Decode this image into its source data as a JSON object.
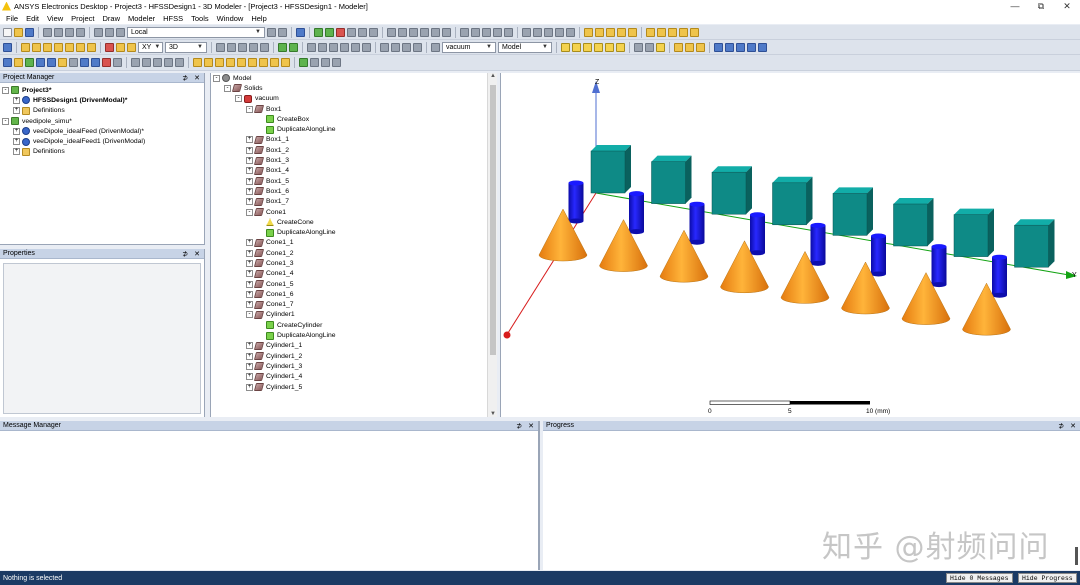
{
  "window": {
    "title": "ANSYS Electronics Desktop - Project3 - HFSSDesign1 - 3D Modeler - [Project3 - HFSSDesign1 - Modeler]",
    "controls": [
      "—",
      "⧉",
      "✕"
    ]
  },
  "menu": [
    "File",
    "Edit",
    "View",
    "Project",
    "Draw",
    "Modeler",
    "HFSS",
    "Tools",
    "Window",
    "Help"
  ],
  "toolbar": {
    "coord_system": "Local",
    "plane": "XY",
    "dim_mode": "3D",
    "material": "vacuum",
    "model_mode": "Model"
  },
  "project_manager": {
    "title": "Project Manager",
    "items": [
      {
        "label": "Project3*",
        "level": 0,
        "icon": "project-icon",
        "exp": "-",
        "bold": true
      },
      {
        "label": "HFSSDesign1 (DrivenModal)*",
        "level": 1,
        "icon": "hfss-design-icon",
        "exp": "+",
        "bold": true
      },
      {
        "label": "Definitions",
        "level": 1,
        "icon": "folder-icon",
        "exp": "+",
        "bold": false
      },
      {
        "label": "veedipole_simu*",
        "level": 0,
        "icon": "project-icon",
        "exp": "-",
        "bold": false
      },
      {
        "label": "veeDipole_idealFeed (DrivenModal)*",
        "level": 1,
        "icon": "hfss-design-icon",
        "exp": "+",
        "bold": false
      },
      {
        "label": "veeDipole_idealFeed1 (DrivenModal)",
        "level": 1,
        "icon": "hfss-design-icon",
        "exp": "+",
        "bold": false
      },
      {
        "label": "Definitions",
        "level": 1,
        "icon": "folder-icon",
        "exp": "+",
        "bold": false
      }
    ]
  },
  "properties": {
    "title": "Properties"
  },
  "model_tree": [
    {
      "label": "Model",
      "level": 0,
      "exp": "-",
      "icon": "model"
    },
    {
      "label": "Solids",
      "level": 1,
      "exp": "-",
      "icon": "solid"
    },
    {
      "label": "vacuum",
      "level": 2,
      "exp": "-",
      "icon": "mat"
    },
    {
      "label": "Box1",
      "level": 3,
      "exp": "-",
      "icon": "solid"
    },
    {
      "label": "CreateBox",
      "level": 4,
      "exp": "",
      "icon": "cmd"
    },
    {
      "label": "DuplicateAlongLine",
      "level": 4,
      "exp": "",
      "icon": "cmd"
    },
    {
      "label": "Box1_1",
      "level": 3,
      "exp": "+",
      "icon": "solid"
    },
    {
      "label": "Box1_2",
      "level": 3,
      "exp": "+",
      "icon": "solid"
    },
    {
      "label": "Box1_3",
      "level": 3,
      "exp": "+",
      "icon": "solid"
    },
    {
      "label": "Box1_4",
      "level": 3,
      "exp": "+",
      "icon": "solid"
    },
    {
      "label": "Box1_5",
      "level": 3,
      "exp": "+",
      "icon": "solid"
    },
    {
      "label": "Box1_6",
      "level": 3,
      "exp": "+",
      "icon": "solid"
    },
    {
      "label": "Box1_7",
      "level": 3,
      "exp": "+",
      "icon": "solid"
    },
    {
      "label": "Cone1",
      "level": 3,
      "exp": "-",
      "icon": "solid"
    },
    {
      "label": "CreateCone",
      "level": 4,
      "exp": "",
      "icon": "cone"
    },
    {
      "label": "DuplicateAlongLine",
      "level": 4,
      "exp": "",
      "icon": "cmd"
    },
    {
      "label": "Cone1_1",
      "level": 3,
      "exp": "+",
      "icon": "solid"
    },
    {
      "label": "Cone1_2",
      "level": 3,
      "exp": "+",
      "icon": "solid"
    },
    {
      "label": "Cone1_3",
      "level": 3,
      "exp": "+",
      "icon": "solid"
    },
    {
      "label": "Cone1_4",
      "level": 3,
      "exp": "+",
      "icon": "solid"
    },
    {
      "label": "Cone1_5",
      "level": 3,
      "exp": "+",
      "icon": "solid"
    },
    {
      "label": "Cone1_6",
      "level": 3,
      "exp": "+",
      "icon": "solid"
    },
    {
      "label": "Cone1_7",
      "level": 3,
      "exp": "+",
      "icon": "solid"
    },
    {
      "label": "Cylinder1",
      "level": 3,
      "exp": "-",
      "icon": "solid"
    },
    {
      "label": "CreateCylinder",
      "level": 4,
      "exp": "",
      "icon": "cmd"
    },
    {
      "label": "DuplicateAlongLine",
      "level": 4,
      "exp": "",
      "icon": "cmd"
    },
    {
      "label": "Cylinder1_1",
      "level": 3,
      "exp": "+",
      "icon": "solid"
    },
    {
      "label": "Cylinder1_2",
      "level": 3,
      "exp": "+",
      "icon": "solid"
    },
    {
      "label": "Cylinder1_3",
      "level": 3,
      "exp": "+",
      "icon": "solid"
    },
    {
      "label": "Cylinder1_4",
      "level": 3,
      "exp": "+",
      "icon": "solid"
    },
    {
      "label": "Cylinder1_5",
      "level": 3,
      "exp": "+",
      "icon": "solid"
    }
  ],
  "viewport": {
    "axis_z": "Z",
    "axis_y": "Y",
    "scale_labels": [
      "0",
      "5",
      "10 (mm)"
    ],
    "colors": {
      "box": "#0e8a86",
      "cylinder": "#1212d8",
      "cone": "#f59a1e",
      "axis_z": "#4f6fd1",
      "axis_y": "#13a313",
      "axis_x": "#d81d1d"
    }
  },
  "message_manager": {
    "title": "Message Manager"
  },
  "progress": {
    "title": "Progress"
  },
  "status": {
    "text": "Nothing is selected",
    "hide_messages": "Hide 0 Messages",
    "hide_progress": "Hide Progress"
  },
  "watermark": "知乎 @射频问问",
  "panel_controls": {
    "pin": "⊅",
    "close": "✕"
  }
}
